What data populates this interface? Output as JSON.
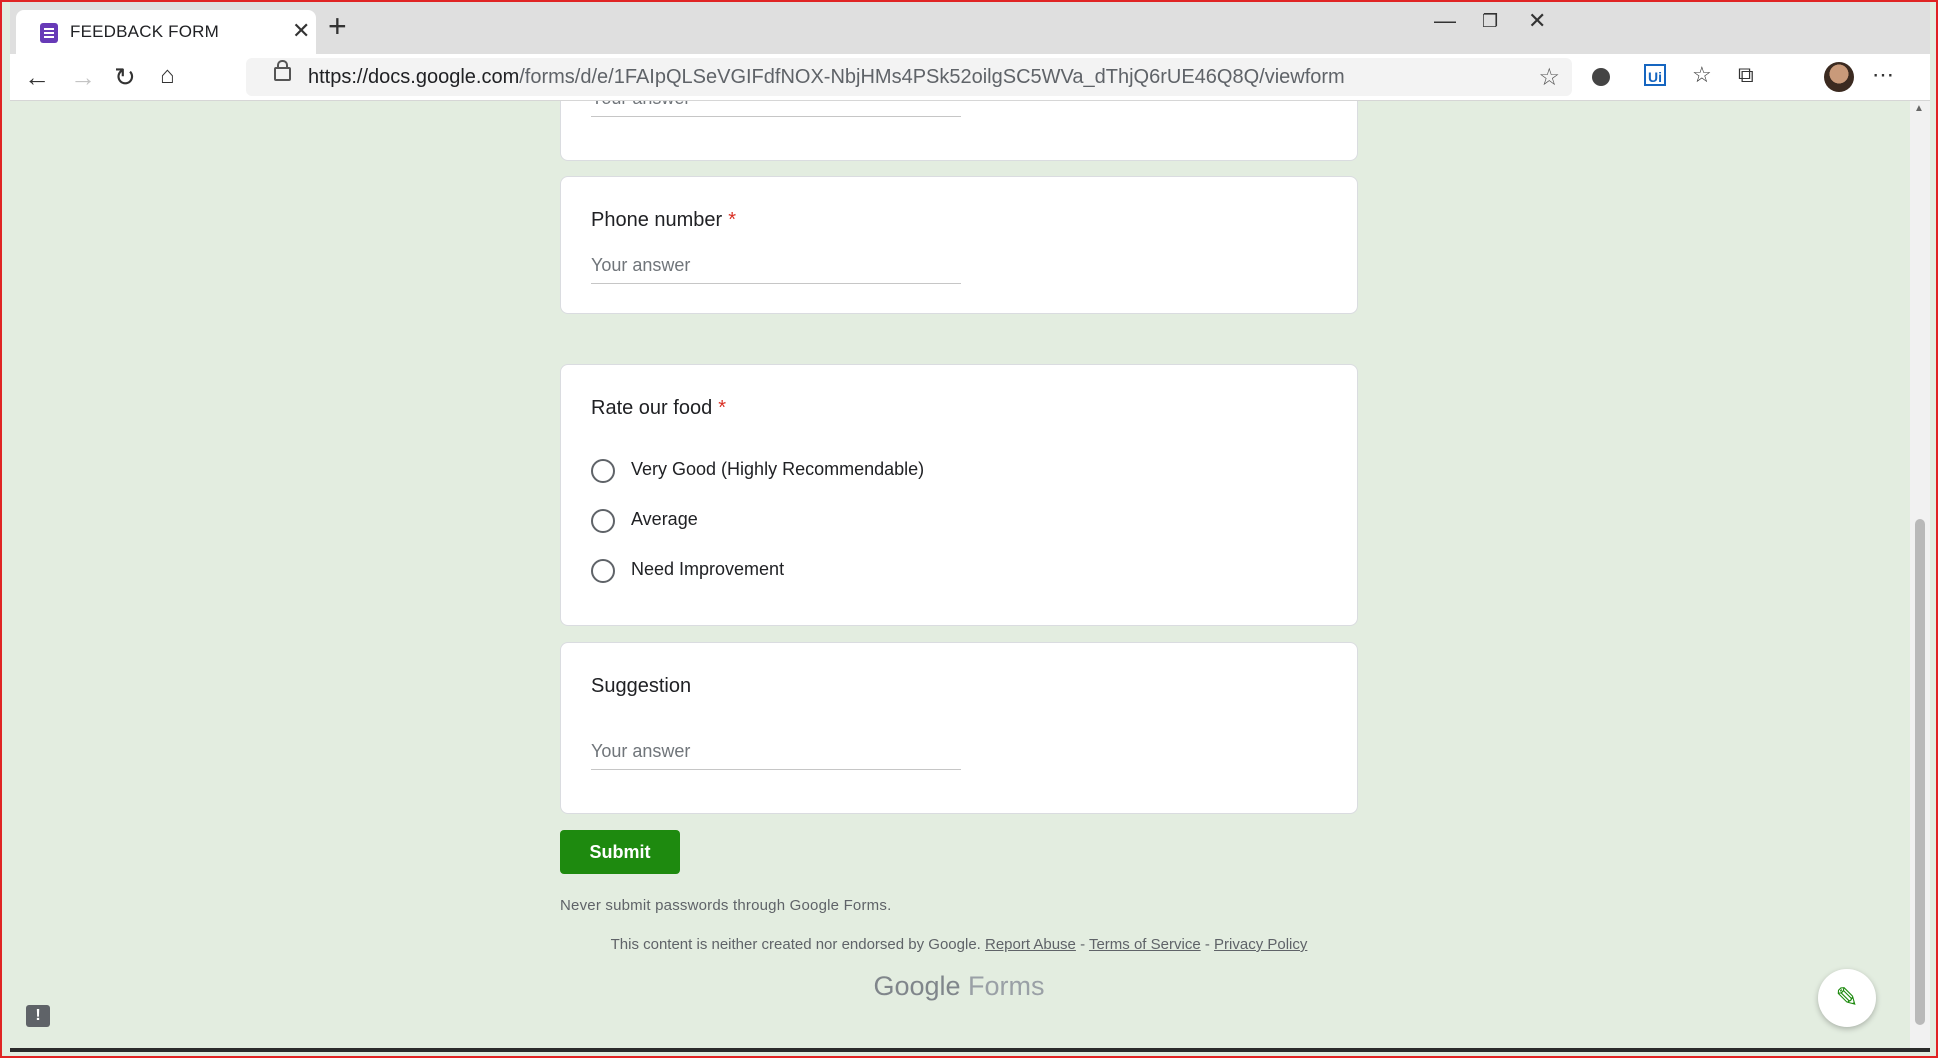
{
  "browser": {
    "tab_title": "FEEDBACK FORM",
    "url_host": "https://docs.google.com",
    "url_path": "/forms/d/e/1FAIpQLSeVGIFdfNOX-NbjHMs4PSk52oilgSC5WVa_dThjQ6rUE46Q8Q/viewform",
    "ext_ui_label": "Ui"
  },
  "form": {
    "partial_answer_placeholder": "Your answer",
    "questions": [
      {
        "title": "Phone number",
        "required_mark": "*",
        "placeholder": "Your answer"
      },
      {
        "title": "Rate our food",
        "required_mark": "*",
        "options": [
          "Very Good (Highly Recommendable)",
          "Average",
          "Need Improvement"
        ]
      },
      {
        "title": "Suggestion",
        "placeholder": "Your answer"
      }
    ],
    "submit_label": "Submit",
    "password_warning": "Never submit passwords through Google Forms."
  },
  "footer": {
    "disclaimer": "This content is neither created nor endorsed by Google.",
    "report_abuse": "Report Abuse",
    "terms": "Terms of Service",
    "privacy": "Privacy Policy",
    "separator": " - ",
    "brand_google": "Google",
    "brand_forms": "Forms"
  },
  "icons": {
    "tab_favicon": "google-forms-icon",
    "edit": "pencil-icon",
    "report": "report-issue-icon"
  },
  "colors": {
    "page_background": "#e3ede0",
    "submit_button": "#1e8a0f",
    "required_asterisk": "#d93025"
  }
}
